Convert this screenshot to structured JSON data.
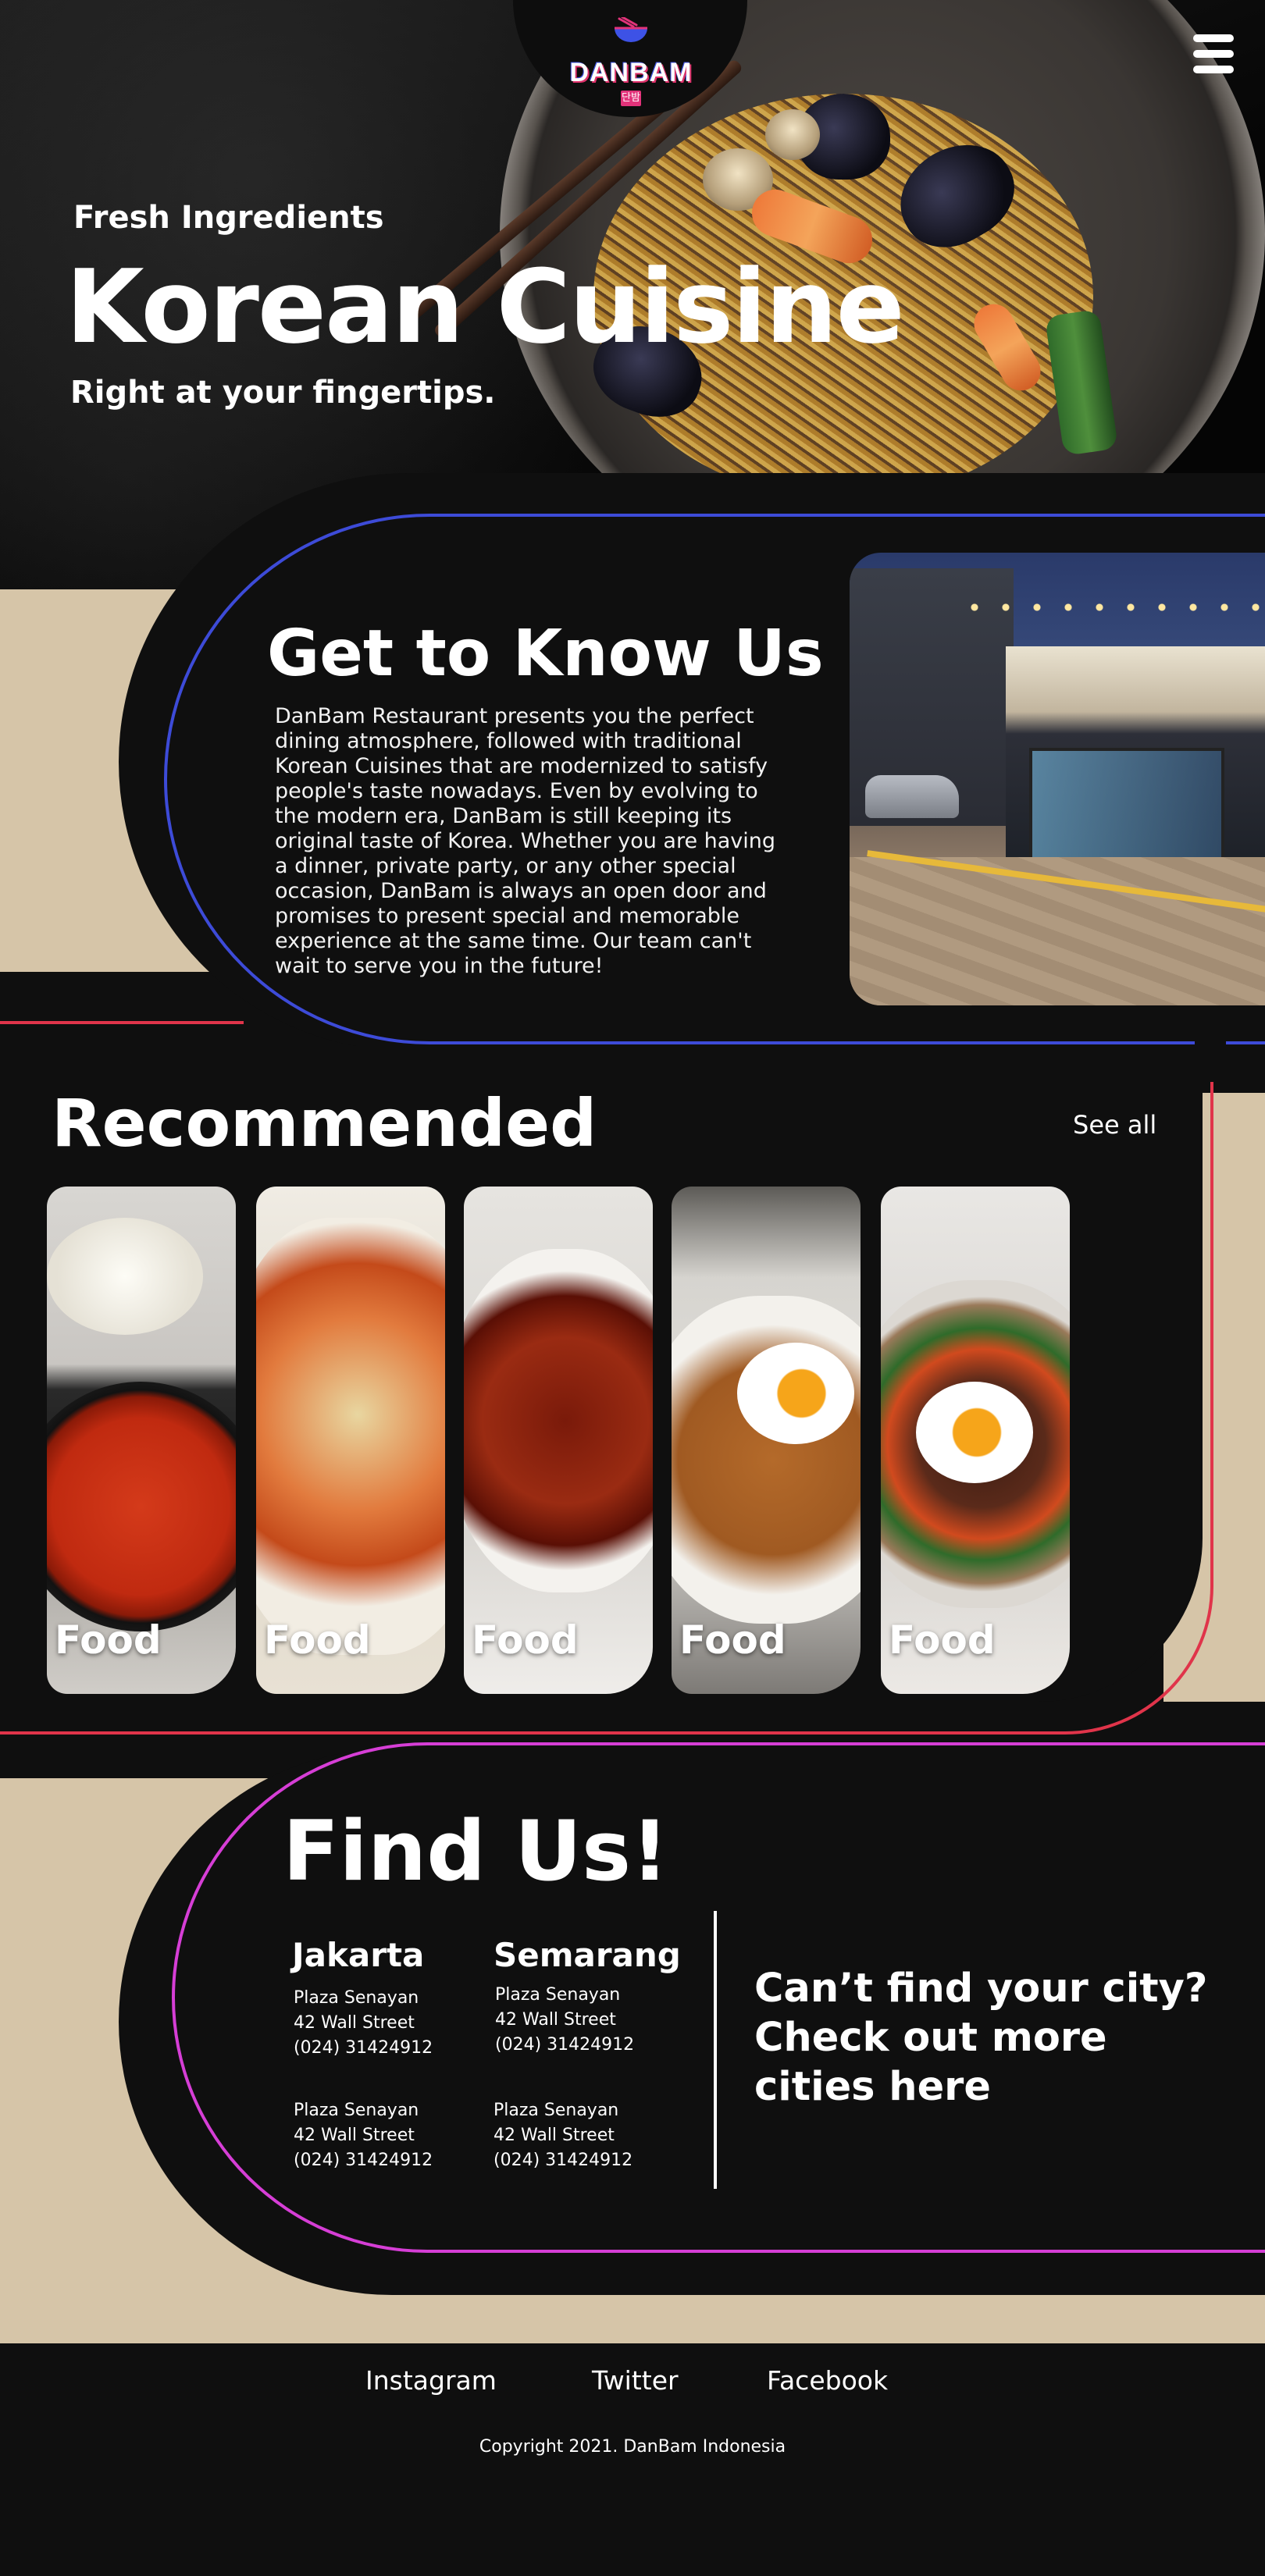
{
  "header": {
    "logo_text": "DANBAM",
    "logo_sub": "단밤",
    "menu_icon": "hamburger-menu-icon"
  },
  "hero": {
    "kicker": "Fresh Ingredients",
    "title": "Korean Cuisine",
    "subtitle": "Right at your fingertips."
  },
  "about": {
    "title": "Get to Know Us",
    "body": "DanBam Restaurant presents you the perfect dining atmosphere, followed with traditional Korean Cuisines that are modernized to satisfy people's taste nowadays. Even by evolving to the modern era, DanBam is still keeping its original taste of Korea. Whether you are having a dinner, private party, or any other special occasion, DanBam is always an open door and promises to present special and memorable experience at the same time. Our team can't wait to serve you in the future!"
  },
  "recommended": {
    "title": "Recommended",
    "see_all": "See all",
    "items": [
      {
        "label": "Food"
      },
      {
        "label": "Food"
      },
      {
        "label": "Food"
      },
      {
        "label": "Food"
      },
      {
        "label": "Food"
      }
    ]
  },
  "find_us": {
    "title": "Find Us!",
    "cities": [
      {
        "name": "Jakarta",
        "addresses": [
          {
            "line1": "Plaza Senayan",
            "line2": "42 Wall Street",
            "line3": "(024) 31424912"
          },
          {
            "line1": "Plaza Senayan",
            "line2": "42 Wall Street",
            "line3": "(024) 31424912"
          }
        ]
      },
      {
        "name": "Semarang",
        "addresses": [
          {
            "line1": "Plaza Senayan",
            "line2": "42 Wall Street",
            "line3": "(024) 31424912"
          },
          {
            "line1": "Plaza Senayan",
            "line2": "42 Wall Street",
            "line3": "(024) 31424912"
          }
        ]
      }
    ],
    "more_cities": "Can’t find your city? Check out more cities here"
  },
  "footer": {
    "links": [
      "Instagram",
      "Twitter",
      "Facebook"
    ],
    "copyright": "Copyright 2021. DanBam Indonesia"
  },
  "colors": {
    "accent_blue": "#3d4bd8",
    "accent_red": "#e0344a",
    "accent_magenta": "#d63ed6",
    "beige": "#d6c5a8",
    "background": "#0f0f0f"
  }
}
